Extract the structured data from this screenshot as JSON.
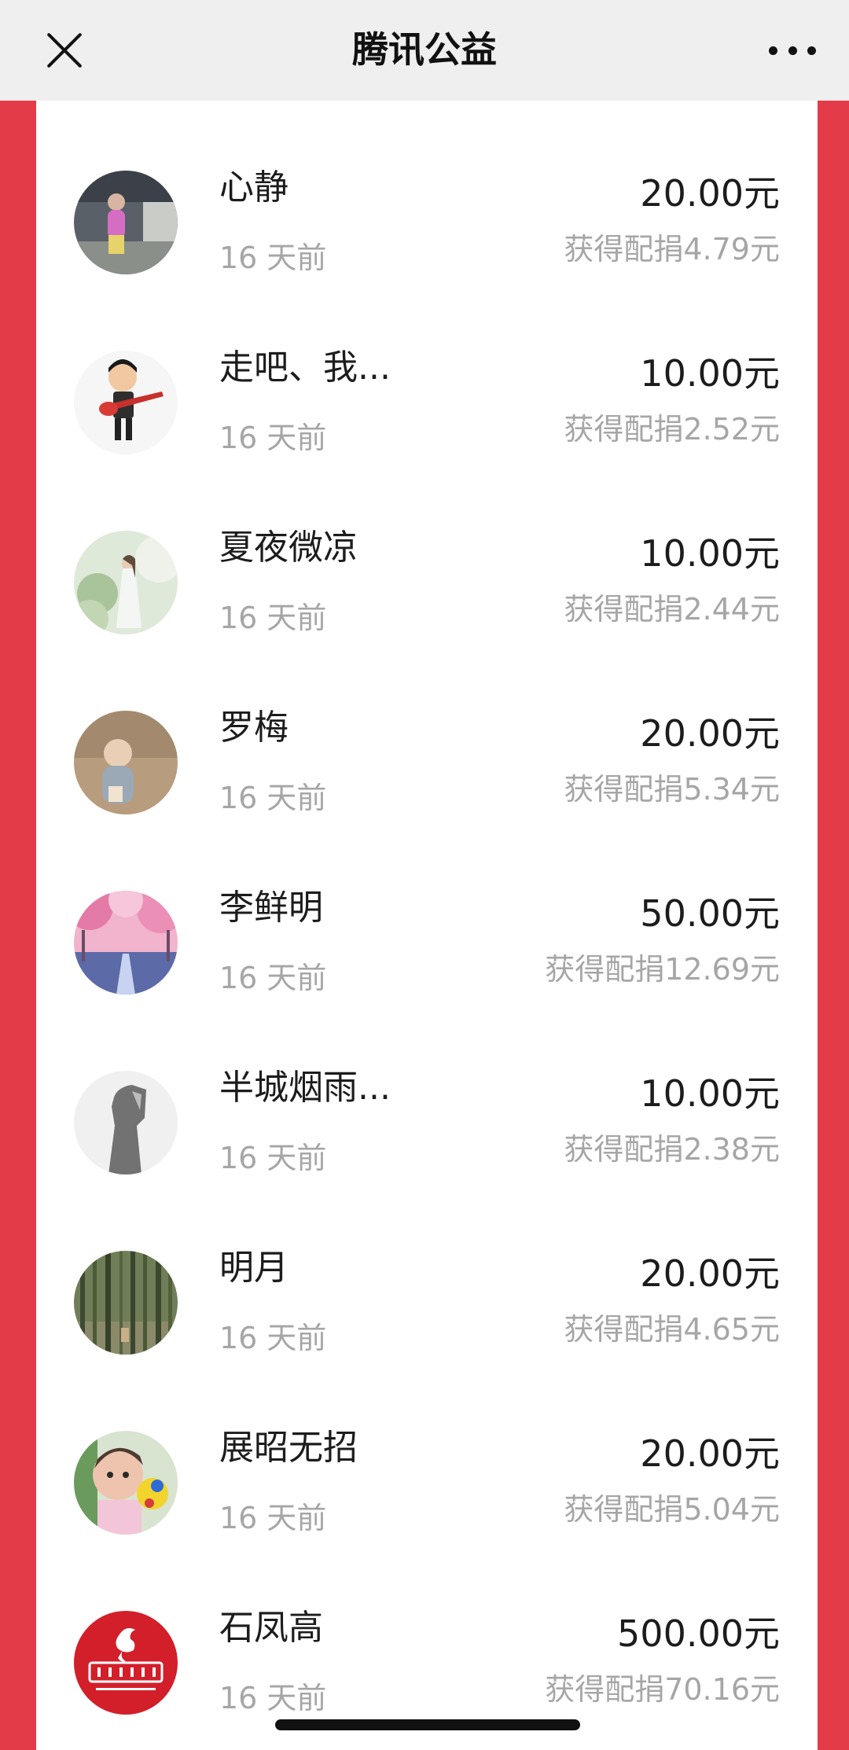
{
  "header": {
    "title": "腾讯公益",
    "close_icon": "close-icon",
    "more_icon": "more-icon"
  },
  "colors": {
    "accent_red": "#e43b49",
    "header_bg": "#efefef",
    "panel_bg": "#ffffff",
    "primary_text": "#1c1c1c",
    "secondary_text": "#a6a6a6"
  },
  "donations": [
    {
      "name": "心静",
      "time": "16 天前",
      "amount": "20.00元",
      "match": "获得配捐4.79元"
    },
    {
      "name": "走吧、我...",
      "time": "16 天前",
      "amount": "10.00元",
      "match": "获得配捐2.52元"
    },
    {
      "name": "夏夜微凉",
      "time": "16 天前",
      "amount": "10.00元",
      "match": "获得配捐2.44元"
    },
    {
      "name": "罗梅",
      "time": "16 天前",
      "amount": "20.00元",
      "match": "获得配捐5.34元"
    },
    {
      "name": "李鲜明",
      "time": "16 天前",
      "amount": "50.00元",
      "match": "获得配捐12.69元"
    },
    {
      "name": "半城烟雨...",
      "time": "16 天前",
      "amount": "10.00元",
      "match": "获得配捐2.38元"
    },
    {
      "name": "明月",
      "time": "16 天前",
      "amount": "20.00元",
      "match": "获得配捐4.65元"
    },
    {
      "name": "展昭无招",
      "time": "16 天前",
      "amount": "20.00元",
      "match": "获得配捐5.04元"
    },
    {
      "name": "石凤高",
      "time": "16 天前",
      "amount": "500.00元",
      "match": "获得配捐70.16元"
    }
  ]
}
